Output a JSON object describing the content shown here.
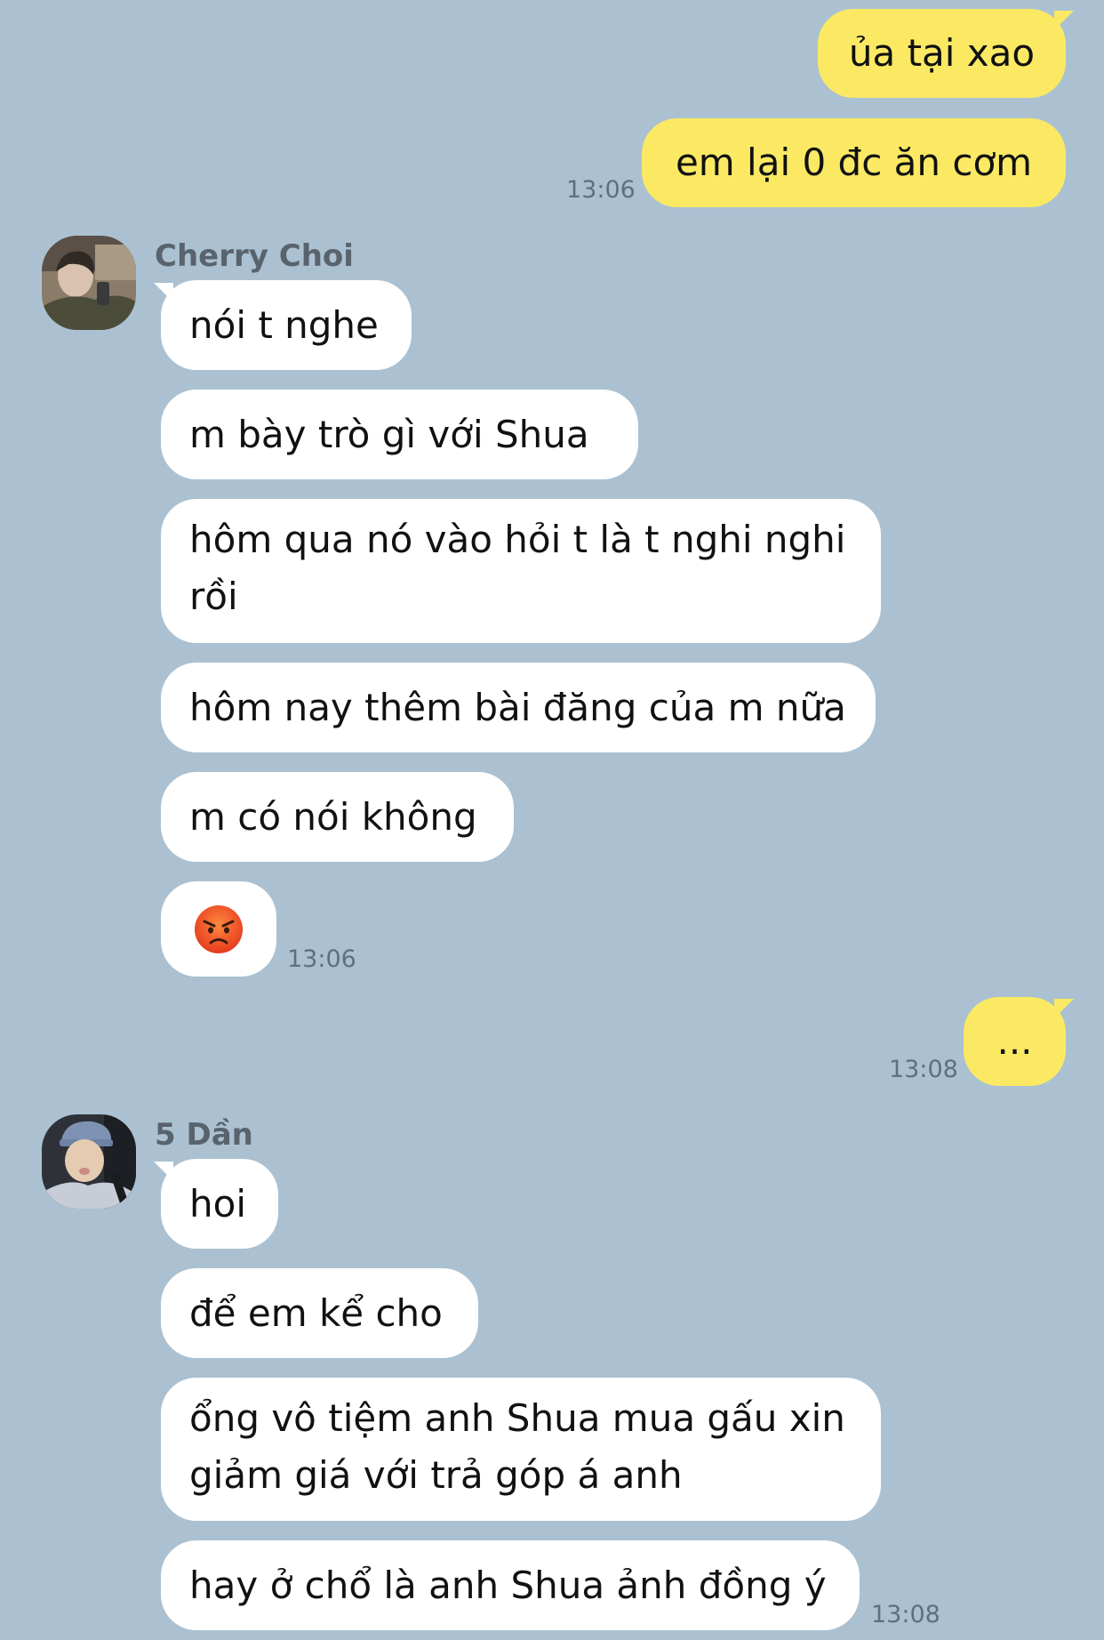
{
  "messages": {
    "out1": {
      "text": "ủa tại xao"
    },
    "out2": {
      "text": "em lại 0 đc ăn cơm",
      "time": "13:06"
    },
    "group1": {
      "sender": "Cherry Choi",
      "m1": "nói t nghe",
      "m2": "m bày trò gì với Shua",
      "m3_line1": "hôm qua nó vào hỏi t là t nghi nghi",
      "m3_line2": "rồi",
      "m4": "hôm nay thêm bài đăng của m nữa",
      "m5": "m có nói không",
      "m6_emoji": "angry-face-emoji",
      "time": "13:06"
    },
    "out3": {
      "text": "...",
      "time": "13:08"
    },
    "group2": {
      "sender": "5 Dần",
      "m1": "hoi",
      "m2": "để em kể cho",
      "m3_line1": "ổng vô tiệm anh Shua mua gấu xin",
      "m3_line2": "giảm giá với trả góp á anh",
      "m4": "hay ở chổ là anh Shua ảnh đồng ý",
      "time": "13:08"
    }
  },
  "colors": {
    "background": "#abc1d1",
    "my_bubble": "#fbe964",
    "their_bubble": "#ffffff",
    "timestamp": "#5f6f7d",
    "sender_name": "#59636d"
  }
}
